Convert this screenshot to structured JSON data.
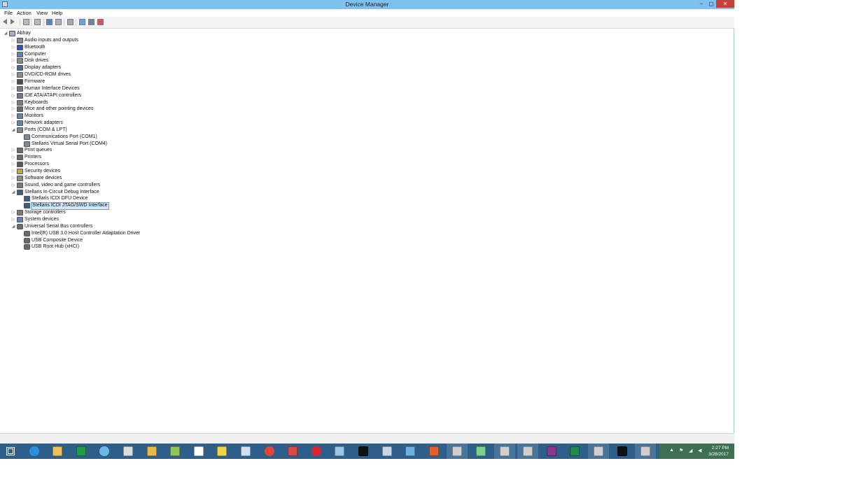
{
  "window": {
    "title": "Device Manager",
    "controls": {
      "minimize": "–",
      "maximize": "▢",
      "close": "✕"
    }
  },
  "menu": [
    "File",
    "Action",
    "View",
    "Help"
  ],
  "toolbar": [
    "back",
    "forward",
    "up",
    "properties",
    "help",
    "show-hide",
    "scan",
    "update-driver",
    "disable",
    "uninstall"
  ],
  "tree": [
    {
      "label": "Abhay",
      "level": 0,
      "expanded": true,
      "icon": "computer-icon"
    },
    {
      "label": "Audio inputs and outputs",
      "level": 1,
      "expanded": false,
      "icon": "speaker-icon"
    },
    {
      "label": "Bluetooth",
      "level": 1,
      "expanded": false,
      "icon": "bluetooth-icon"
    },
    {
      "label": "Computer",
      "level": 1,
      "expanded": false,
      "icon": "monitor-icon"
    },
    {
      "label": "Disk drives",
      "level": 1,
      "expanded": false,
      "icon": "disk-icon"
    },
    {
      "label": "Display adapters",
      "level": 1,
      "expanded": false,
      "icon": "display-adapter-icon"
    },
    {
      "label": "DVD/CD-ROM drives",
      "level": 1,
      "expanded": false,
      "icon": "dvd-icon"
    },
    {
      "label": "Firmware",
      "level": 1,
      "expanded": false,
      "icon": "chip-icon"
    },
    {
      "label": "Human Interface Devices",
      "level": 1,
      "expanded": false,
      "icon": "hid-icon"
    },
    {
      "label": "IDE ATA/ATAPI controllers",
      "level": 1,
      "expanded": false,
      "icon": "ide-icon"
    },
    {
      "label": "Keyboards",
      "level": 1,
      "expanded": false,
      "icon": "keyboard-icon"
    },
    {
      "label": "Mice and other pointing devices",
      "level": 1,
      "expanded": false,
      "icon": "mouse-icon"
    },
    {
      "label": "Monitors",
      "level": 1,
      "expanded": false,
      "icon": "monitor-icon"
    },
    {
      "label": "Network adapters",
      "level": 1,
      "expanded": false,
      "icon": "network-icon"
    },
    {
      "label": "Ports (COM & LPT)",
      "level": 1,
      "expanded": true,
      "icon": "port-icon"
    },
    {
      "label": "Communications Port (COM1)",
      "level": 2,
      "icon": "port-icon"
    },
    {
      "label": "Stellaris Virtual Serial Port (COM4)",
      "level": 2,
      "icon": "port-icon"
    },
    {
      "label": "Print queues",
      "level": 1,
      "expanded": false,
      "icon": "printer-icon"
    },
    {
      "label": "Printers",
      "level": 1,
      "expanded": false,
      "icon": "printer-icon"
    },
    {
      "label": "Processors",
      "level": 1,
      "expanded": false,
      "icon": "processor-icon"
    },
    {
      "label": "Security devices",
      "level": 1,
      "expanded": false,
      "icon": "security-icon"
    },
    {
      "label": "Software devices",
      "level": 1,
      "expanded": false,
      "icon": "software-icon"
    },
    {
      "label": "Sound, video and game controllers",
      "level": 1,
      "expanded": false,
      "icon": "sound-icon"
    },
    {
      "label": "Stellaris In-Circuit Debug Interface",
      "level": 1,
      "expanded": true,
      "icon": "debug-icon"
    },
    {
      "label": "Stellaris ICDI DFU Device",
      "level": 2,
      "icon": "debug-icon"
    },
    {
      "label": "Stellaris ICDI JTAG/SWD Interface",
      "level": 2,
      "icon": "debug-icon",
      "selected": true
    },
    {
      "label": "Storage controllers",
      "level": 1,
      "expanded": false,
      "icon": "storage-icon"
    },
    {
      "label": "System devices",
      "level": 1,
      "expanded": false,
      "icon": "system-icon"
    },
    {
      "label": "Universal Serial Bus controllers",
      "level": 1,
      "expanded": true,
      "icon": "usb-icon"
    },
    {
      "label": "Intel(R) USB 3.0 Host Controller Adaptation Driver",
      "level": 2,
      "icon": "usb-icon"
    },
    {
      "label": "USB Composite Device",
      "level": 2,
      "icon": "usb-icon"
    },
    {
      "label": "USB Root Hub (xHCI)",
      "level": 2,
      "icon": "usb-icon"
    }
  ],
  "taskbar": {
    "apps": [
      {
        "name": "start-icon",
        "color": "#ffffff"
      },
      {
        "name": "internet-explorer-icon",
        "color": "#2b8fdc"
      },
      {
        "name": "file-explorer-icon",
        "color": "#e8c45a"
      },
      {
        "name": "store-icon",
        "color": "#1f9b4a"
      },
      {
        "name": "settings-icon",
        "color": "#6fb7e8"
      },
      {
        "name": "ccleaner-icon",
        "color": "#dddddd"
      },
      {
        "name": "mail-icon",
        "color": "#e9b84a"
      },
      {
        "name": "android-studio-icon",
        "color": "#8fc65b"
      },
      {
        "name": "notepad-icon",
        "color": "#ffffff"
      },
      {
        "name": "python-icon",
        "color": "#f2d44a"
      },
      {
        "name": "document-icon",
        "color": "#cfe1f3"
      },
      {
        "name": "chrome-icon",
        "color": "#e0453a"
      },
      {
        "name": "paint-icon",
        "color": "#d84a4a"
      },
      {
        "name": "reader-icon",
        "color": "#d9262c"
      },
      {
        "name": "tools-icon",
        "color": "#9cc4e6"
      },
      {
        "name": "terminal-icon",
        "color": "#111111"
      },
      {
        "name": "virtualbox-icon",
        "color": "#c8d7e6"
      },
      {
        "name": "network-icon",
        "color": "#6fb1e3"
      },
      {
        "name": "office-icon",
        "color": "#e1612a"
      },
      {
        "name": "device-icon",
        "color": "#cfcfcf"
      },
      {
        "name": "package-icon",
        "color": "#7cd18a"
      },
      {
        "name": "device-icon",
        "color": "#cfcfcf"
      },
      {
        "name": "device-icon",
        "color": "#cfcfcf"
      },
      {
        "name": "winrar-icon",
        "color": "#8a3a8a"
      },
      {
        "name": "excel-icon",
        "color": "#1f8a4a"
      },
      {
        "name": "device-icon",
        "color": "#cfcfcf"
      },
      {
        "name": "ti-icon",
        "color": "#111111"
      },
      {
        "name": "device-manager-icon",
        "color": "#cfcfcf"
      }
    ],
    "clock": {
      "time": "2:27 PM",
      "date": "3/28/2017"
    }
  }
}
